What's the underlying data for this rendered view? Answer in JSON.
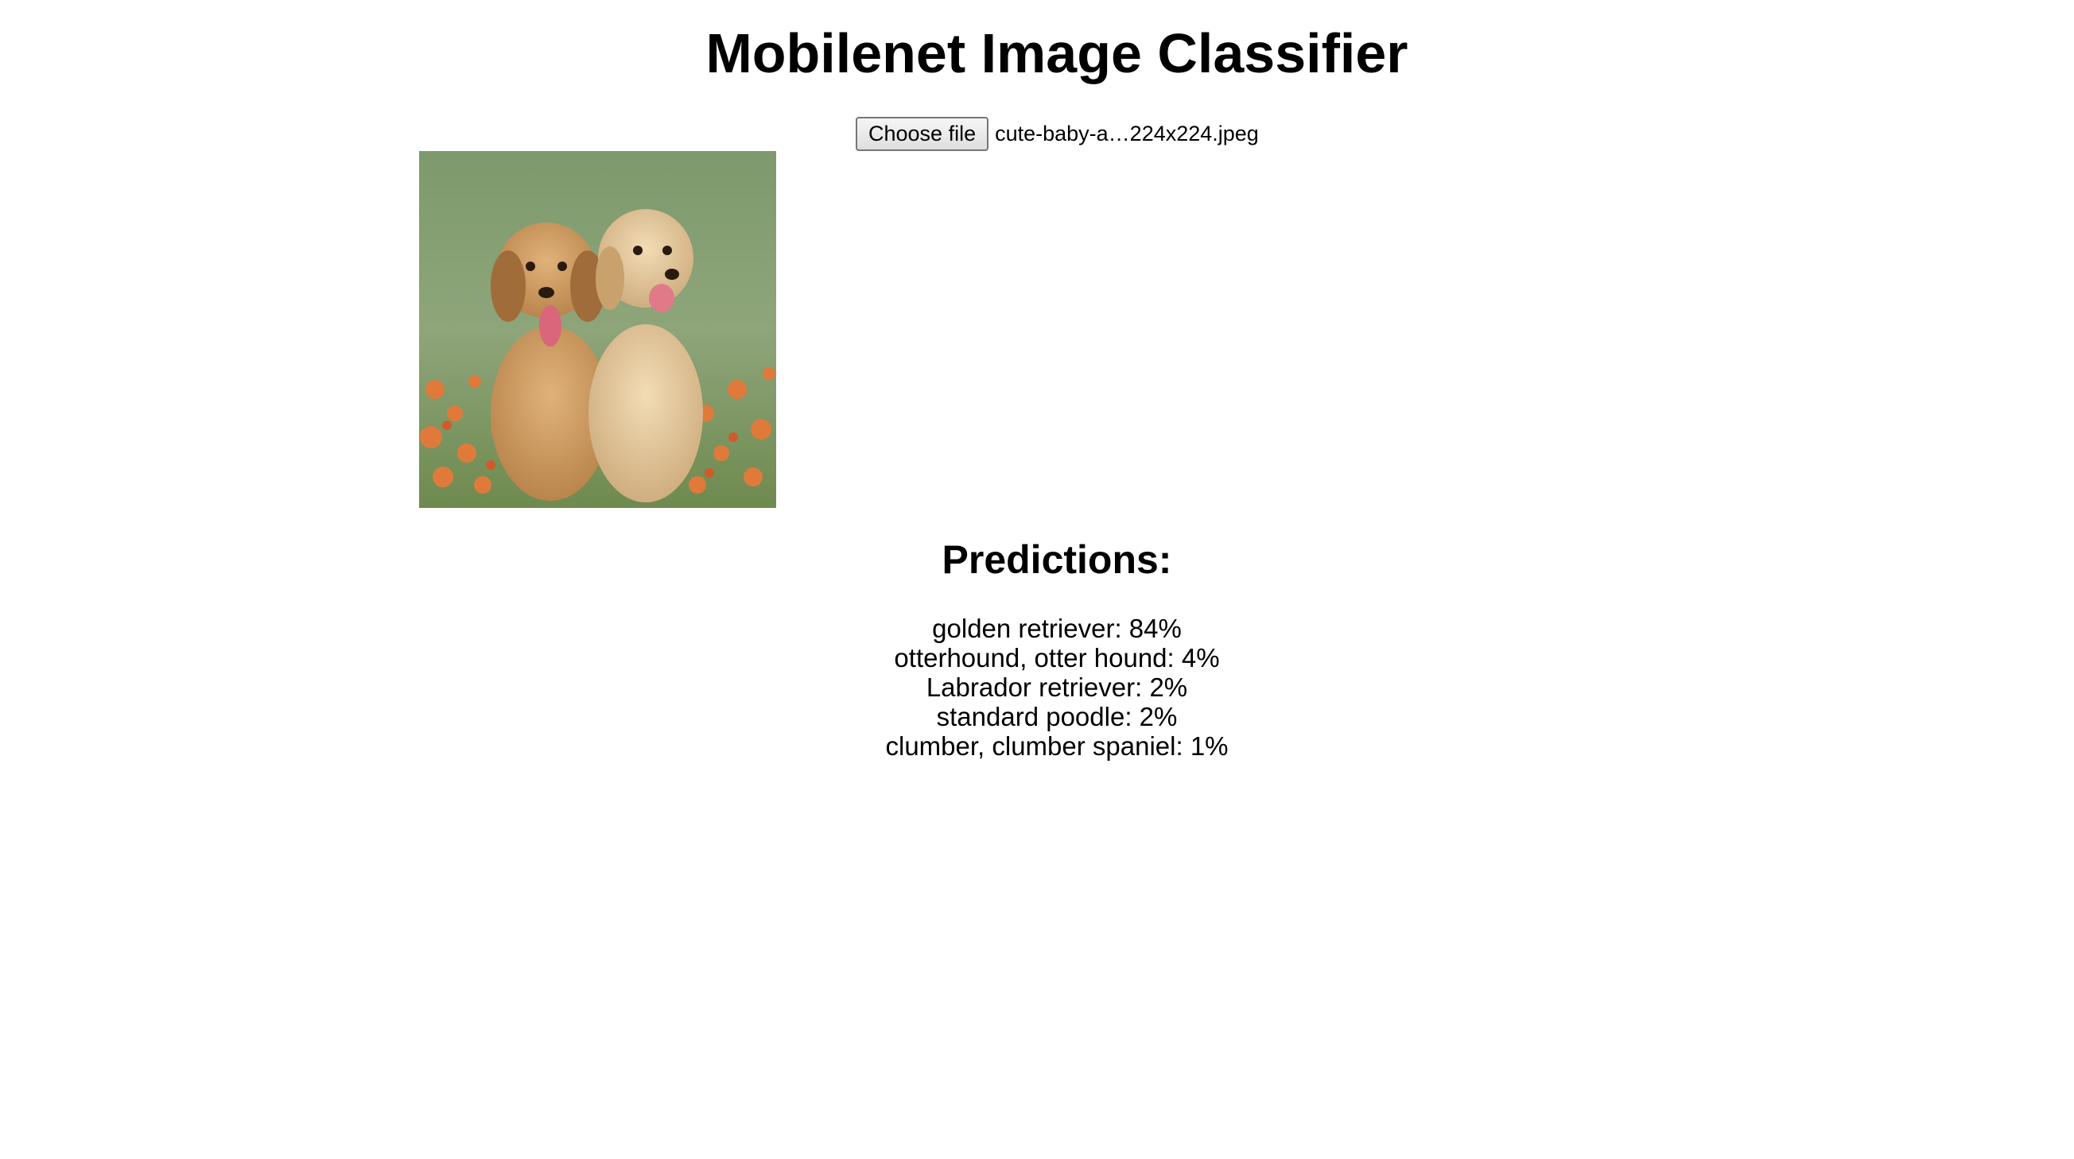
{
  "page": {
    "title": "Mobilenet Image Classifier"
  },
  "file_input": {
    "button_label": "Choose file",
    "file_name": "cute-baby-a…224x224.jpeg"
  },
  "image": {
    "description_icon": "photo-preview"
  },
  "predictions": {
    "heading": "Predictions:",
    "items": [
      {
        "label": "golden retriever: 84%"
      },
      {
        "label": "otterhound, otter hound: 4%"
      },
      {
        "label": "Labrador retriever: 2%"
      },
      {
        "label": "standard poodle: 2%"
      },
      {
        "label": "clumber, clumber spaniel: 1%"
      }
    ]
  }
}
